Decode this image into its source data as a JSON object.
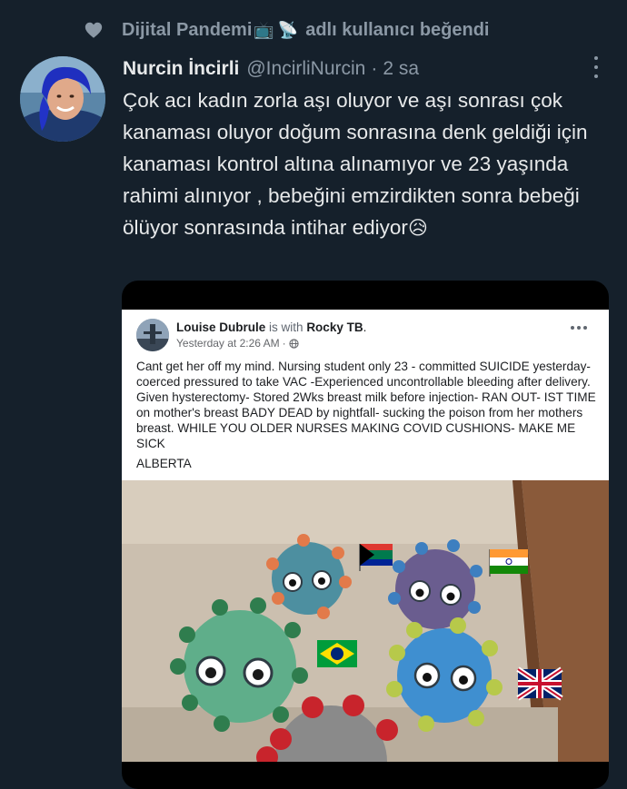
{
  "social_context": {
    "liker_name": "Dijital Pandemi",
    "emoji_1": "📺",
    "emoji_2": "📡",
    "suffix": "adlı kullanıcı beğendi"
  },
  "tweet": {
    "author_name": "Nurcin İncirli",
    "handle": "@IncirliNurcin",
    "separator": "·",
    "time": "2 sa",
    "text": "Çok acı kadın zorla aşı oluyor ve aşı sonrası çok kanaması oluyor doğum sonrasına denk geldiği için kanaması kontrol altına alınamıyor ve 23 yaşında rahimi alınıyor , bebeğini emzirdikten sonra bebeği ölüyor sonrasında intihar ediyor",
    "text_emoji": "😥"
  },
  "embedded_post": {
    "author": "Louise Dubrule",
    "with_text": "is with",
    "tagged": "Rocky TB",
    "period": ".",
    "timestamp": "Yesterday at 2:26 AM",
    "timestamp_sep": "·",
    "body": "Cant get her off my mind. Nursing student only 23 - committed SUICIDE yesterday- coerced pressured to take VAC -Experienced uncontrollable bleeding after delivery. Given hysterectomy- Stored 2Wks breast milk before injection- RAN OUT- IST TIME on mother's breast BADY DEAD by nightfall- sucking the poison from her mothers breast. WHILE YOU OLDER NURSES MAKING COVID CUSHIONS- MAKE ME SICK",
    "location": "ALBERTA"
  },
  "colors": {
    "background": "#15202b",
    "text_primary": "#e7e9ea",
    "text_secondary": "#8b98a5"
  },
  "icons": {
    "like_indicator": "heart-icon",
    "tweet_menu": "more-vertical-icon",
    "post_menu": "more-horizontal-icon",
    "audience": "globe-icon"
  }
}
